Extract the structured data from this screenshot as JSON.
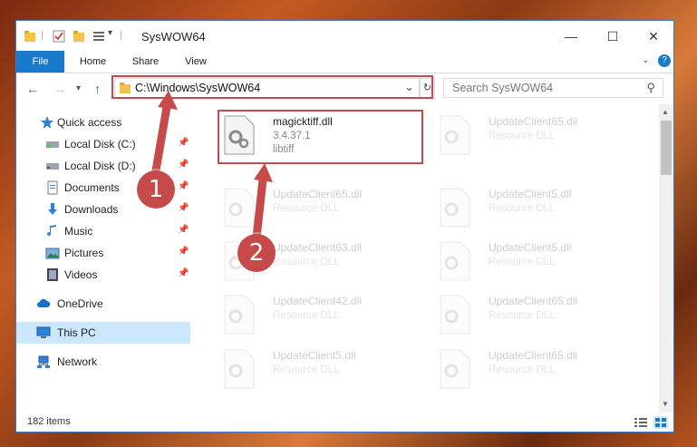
{
  "window": {
    "title": "SysWOW64",
    "controls": {
      "minimize": "—",
      "maximize": "☐",
      "close": "✕"
    }
  },
  "ribbon": {
    "tabs": [
      "File",
      "Home",
      "Share",
      "View"
    ],
    "collapse_icon": "chevron-down-icon",
    "help_icon": "help-icon",
    "help_label": "?"
  },
  "navigation": {
    "back": "←",
    "forward": "→",
    "recent": "▾",
    "up": "↑",
    "address": "C:\\Windows\\SysWOW64",
    "address_dropdown": "⌄",
    "refresh": "↻",
    "search_placeholder": "Search SysWOW64",
    "search_icon": "⚲"
  },
  "sidebar": {
    "items": [
      {
        "label": "Quick access",
        "icon": "star-icon",
        "pinned": false
      },
      {
        "label": "Local Disk (C:)",
        "icon": "drive-icon",
        "pinned": true
      },
      {
        "label": "Local Disk (D:)",
        "icon": "drive-icon",
        "pinned": true
      },
      {
        "label": "Documents",
        "icon": "documents-icon",
        "pinned": true
      },
      {
        "label": "Downloads",
        "icon": "download-icon",
        "pinned": true
      },
      {
        "label": "Music",
        "icon": "music-icon",
        "pinned": true
      },
      {
        "label": "Pictures",
        "icon": "pictures-icon",
        "pinned": true
      },
      {
        "label": "Videos",
        "icon": "videos-icon",
        "pinned": true
      },
      {
        "label": "OneDrive",
        "icon": "cloud-icon",
        "pinned": false
      },
      {
        "label": "This PC",
        "icon": "computer-icon",
        "pinned": false,
        "selected": true
      },
      {
        "label": "Network",
        "icon": "network-icon",
        "pinned": false
      }
    ],
    "pin_glyph": "📌"
  },
  "files": {
    "highlighted": {
      "name": "magicktiff.dll",
      "version": "3.4.37.1",
      "description": "libtiff"
    },
    "left_column": [
      {
        "name": "UpdateClient65.dll",
        "type": "Resource DLL"
      },
      {
        "name": "UpdateClient63.dll",
        "type": "Resource DLL"
      },
      {
        "name": "UpdateClient42.dll",
        "type": "Resource DLL"
      },
      {
        "name": "UpdateClient5.dll",
        "type": "Resource DLL"
      }
    ],
    "right_column": [
      {
        "name": "UpdateClient65.dll",
        "type": "Resource DLL"
      },
      {
        "name": "UpdateClient5.dll",
        "type": "Resource DLL"
      },
      {
        "name": "UpdateClient5.dll",
        "type": "Resource DLL"
      },
      {
        "name": "UpdateClient65.dll",
        "type": "Resource DLL"
      },
      {
        "name": "UpdateClient65.dll",
        "type": "Resource DLL"
      }
    ]
  },
  "status": {
    "item_count": "182 items"
  },
  "annotations": {
    "step1": "1",
    "step2": "2"
  },
  "colors": {
    "accent": "#1979ca",
    "annotation": "#c74a4a",
    "selected": "#cce8ff"
  }
}
